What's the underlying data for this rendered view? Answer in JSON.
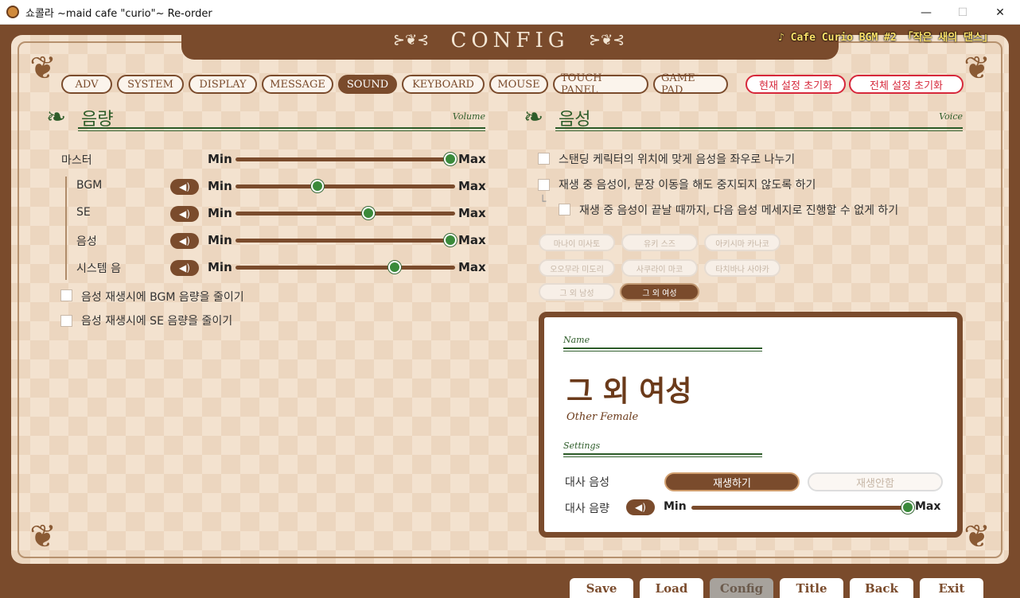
{
  "window": {
    "title": "쇼콜라 ~maid cafe \"curio\"~ Re-order",
    "minimize_glyph": "—",
    "maximize_glyph": "☐",
    "close_glyph": "✕"
  },
  "header": {
    "title": "CONFIG",
    "ornament_left": "⊱❦⊰",
    "ornament_right": "⊱❦⊰",
    "bgm_text": "♪ Cafe Curio BGM #2 「작은 새의 댄스」"
  },
  "tabs": [
    {
      "label": "ADV"
    },
    {
      "label": "SYSTEM"
    },
    {
      "label": "DISPLAY"
    },
    {
      "label": "MESSAGE"
    },
    {
      "label": "SOUND",
      "active": true
    },
    {
      "label": "KEYBOARD"
    },
    {
      "label": "MOUSE"
    },
    {
      "label": "TOUCH PANEL"
    },
    {
      "label": "GAME PAD"
    }
  ],
  "reset": {
    "current": "현재 설정 초기화",
    "all": "전체 설정 초기화"
  },
  "volume": {
    "title": "음량",
    "subtitle": "Volume",
    "min_label": "Min",
    "max_label": "Max",
    "speaker_glyph": "◀)",
    "rows": [
      {
        "label": "마스터",
        "level": 1.0
      },
      {
        "label": "BGM",
        "level": 0.38
      },
      {
        "label": "SE",
        "level": 0.62
      },
      {
        "label": "음성",
        "level": 1.0
      },
      {
        "label": "시스템 음",
        "level": 0.74
      }
    ],
    "options": [
      {
        "label": "음성 재생시에 BGM 음량을 줄이기",
        "checked": false
      },
      {
        "label": "음성 재생시에 SE 음량을 줄이기",
        "checked": false
      }
    ]
  },
  "voice": {
    "title": "음성",
    "subtitle": "Voice",
    "options": [
      {
        "label": "스탠딩 케릭터의 위치에 맞게 음성을 좌우로 나누기"
      },
      {
        "label": "재생 중 음성이, 문장 이동을 해도 중지되지 않도록 하기"
      },
      {
        "label": "재생 중 음성이 끝날 때까지, 다음 음성 메세지로 진행할 수 없게 하기"
      }
    ],
    "sub_glyph": "└",
    "characters": [
      {
        "label": "마나이 미사토"
      },
      {
        "label": "유키 스즈"
      },
      {
        "label": "아키시마 카나코"
      },
      {
        "label": "오오무라 미도리"
      },
      {
        "label": "사쿠라이 마코"
      },
      {
        "label": "타치바나 사야카"
      },
      {
        "label": "그 외 남성"
      },
      {
        "label": "그 외 여성",
        "active": true
      }
    ],
    "card": {
      "name_heading": "Name",
      "name": "그 외 여성",
      "name_en": "Other Female",
      "settings_heading": "Settings",
      "dialogue_voice_label": "대사 음성",
      "play_on": "재생하기",
      "play_off": "재생안함",
      "dialogue_volume_label": "대사 음량",
      "min_label": "Min",
      "max_label": "Max",
      "dialogue_volume_level": 1.0
    }
  },
  "bottom": [
    {
      "label": "Save"
    },
    {
      "label": "Load"
    },
    {
      "label": "Config",
      "active": true
    },
    {
      "label": "Title"
    },
    {
      "label": "Back"
    },
    {
      "label": "Exit"
    }
  ],
  "colors": {
    "brown": "#7a4b2c",
    "green": "#2e5d2a",
    "knob": "#3a8a3a",
    "reset_red": "#d6283b"
  }
}
